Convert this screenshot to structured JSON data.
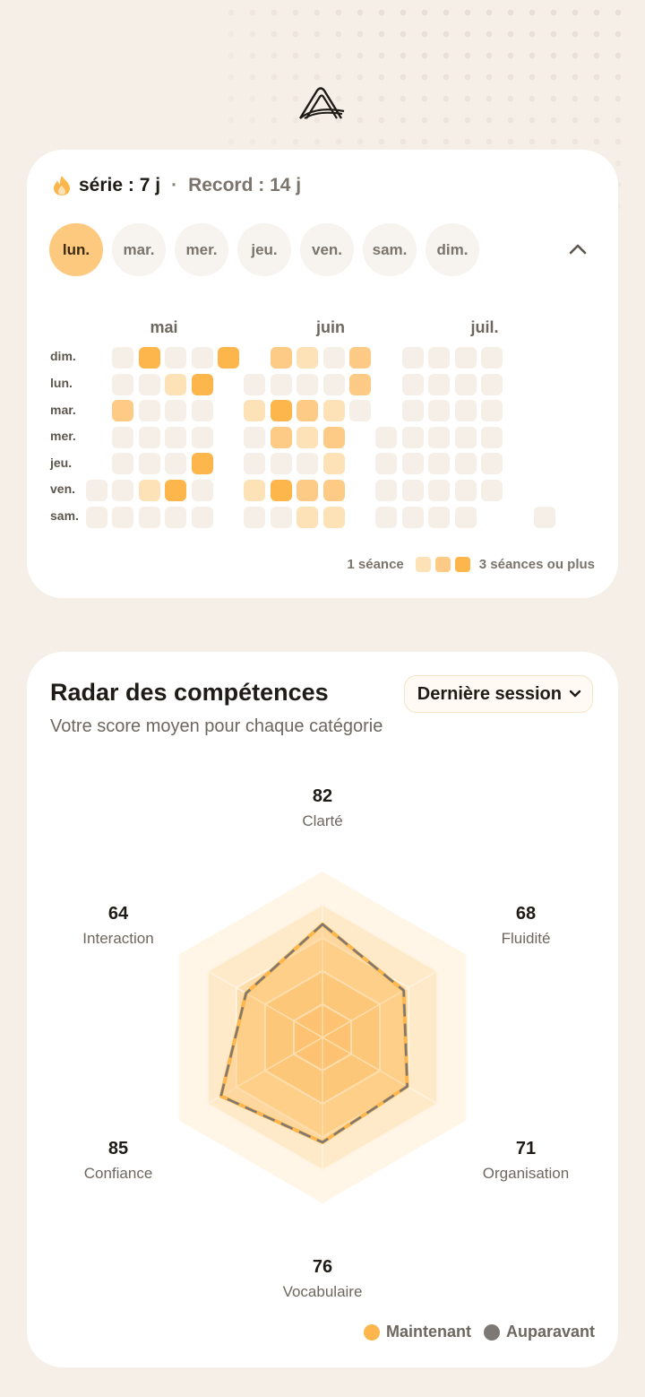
{
  "streak": {
    "label": "série : 7 j",
    "separator": "·",
    "record_label": "Record : 14 j",
    "days": [
      "lun.",
      "mar.",
      "mer.",
      "jeu.",
      "ven.",
      "sam.",
      "dim."
    ],
    "active_day_index": 0,
    "months": [
      "mai",
      "juin",
      "juil."
    ],
    "weekday_labels": [
      "dim.",
      "lun.",
      "mar.",
      "mer.",
      "jeu.",
      "ven.",
      "sam."
    ],
    "legend_low": "1 séance",
    "legend_high": "3 séances ou plus",
    "heatmap_weeks": [
      [
        null,
        null,
        null,
        null,
        null,
        0,
        0
      ],
      [
        0,
        0,
        2,
        0,
        0,
        0,
        0
      ],
      [
        3,
        0,
        0,
        0,
        0,
        1,
        0
      ],
      [
        0,
        1,
        0,
        0,
        0,
        3,
        0
      ],
      [
        0,
        3,
        0,
        0,
        3,
        0,
        0
      ],
      [
        3,
        null,
        null,
        null,
        null,
        null,
        null
      ],
      [
        null,
        0,
        1,
        0,
        0,
        1,
        0
      ],
      [
        2,
        0,
        3,
        2,
        0,
        3,
        0
      ],
      [
        1,
        0,
        2,
        1,
        0,
        2,
        1
      ],
      [
        0,
        0,
        1,
        2,
        1,
        2,
        1
      ],
      [
        2,
        2,
        0,
        null,
        null,
        null,
        null
      ],
      [
        null,
        null,
        null,
        0,
        0,
        0,
        0
      ],
      [
        0,
        0,
        0,
        0,
        0,
        0,
        0
      ],
      [
        0,
        0,
        0,
        0,
        0,
        0,
        0
      ],
      [
        0,
        0,
        0,
        0,
        0,
        0,
        0
      ],
      [
        0,
        0,
        0,
        0,
        0,
        0,
        null
      ],
      [
        null,
        null,
        null,
        null,
        null,
        null,
        null
      ],
      [
        null,
        null,
        null,
        null,
        null,
        null,
        0
      ]
    ],
    "colors": {
      "l0": "#f5efe8",
      "l1": "#fde2b8",
      "l2": "#fdcb85",
      "l3": "#fdb64c"
    }
  },
  "radar": {
    "title": "Radar des compétences",
    "subtitle": "Votre score moyen pour chaque catégorie",
    "period": "Dernière session",
    "axes": [
      {
        "label": "Clarté",
        "value": "82"
      },
      {
        "label": "Fluidité",
        "value": "68"
      },
      {
        "label": "Organisation",
        "value": "71"
      },
      {
        "label": "Vocabulaire",
        "value": "76"
      },
      {
        "label": "Confiance",
        "value": "85"
      },
      {
        "label": "Interaction",
        "value": "64"
      }
    ],
    "legend_now": "Maintenant",
    "legend_before": "Auparavant",
    "color_now": "#fdb64c",
    "color_before": "#7d7873"
  }
}
